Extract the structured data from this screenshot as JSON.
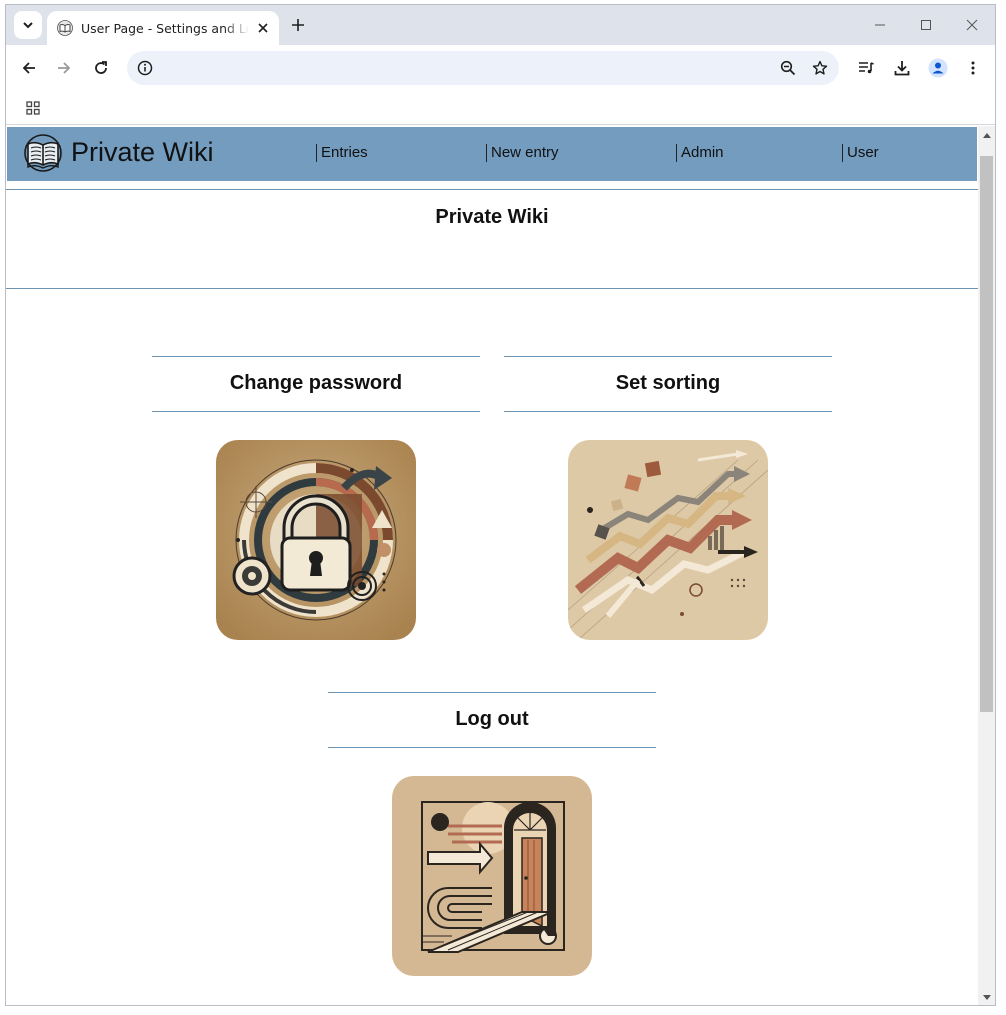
{
  "browser": {
    "tab_title": "User Page - Settings and Logout",
    "url": "",
    "icons": {
      "tab_search": "chevron-down-icon",
      "tab_close": "close-icon",
      "new_tab": "plus-icon",
      "back": "arrow-left-icon",
      "forward": "arrow-right-icon",
      "reload": "reload-icon",
      "site_info": "info-icon",
      "zoom": "zoom-out-icon",
      "bookmark": "star-icon",
      "media": "media-queue-icon",
      "downloads": "download-icon",
      "profile": "profile-icon",
      "menu": "more-vert-icon",
      "apps": "apps-grid-icon"
    }
  },
  "site": {
    "title": "Private Wiki",
    "nav": [
      {
        "label": "Entries"
      },
      {
        "label": "New entry"
      },
      {
        "label": "Admin"
      },
      {
        "label": "User"
      }
    ],
    "colors": {
      "header_bg": "#739cbf",
      "rule": "#6d93b3"
    }
  },
  "main": {
    "heading": "Private Wiki",
    "cards": [
      {
        "title": "Change password",
        "image": "padlock-illustration"
      },
      {
        "title": "Set sorting",
        "image": "sorting-arrows-illustration"
      },
      {
        "title": "Log out",
        "image": "doorway-exit-illustration"
      }
    ]
  }
}
